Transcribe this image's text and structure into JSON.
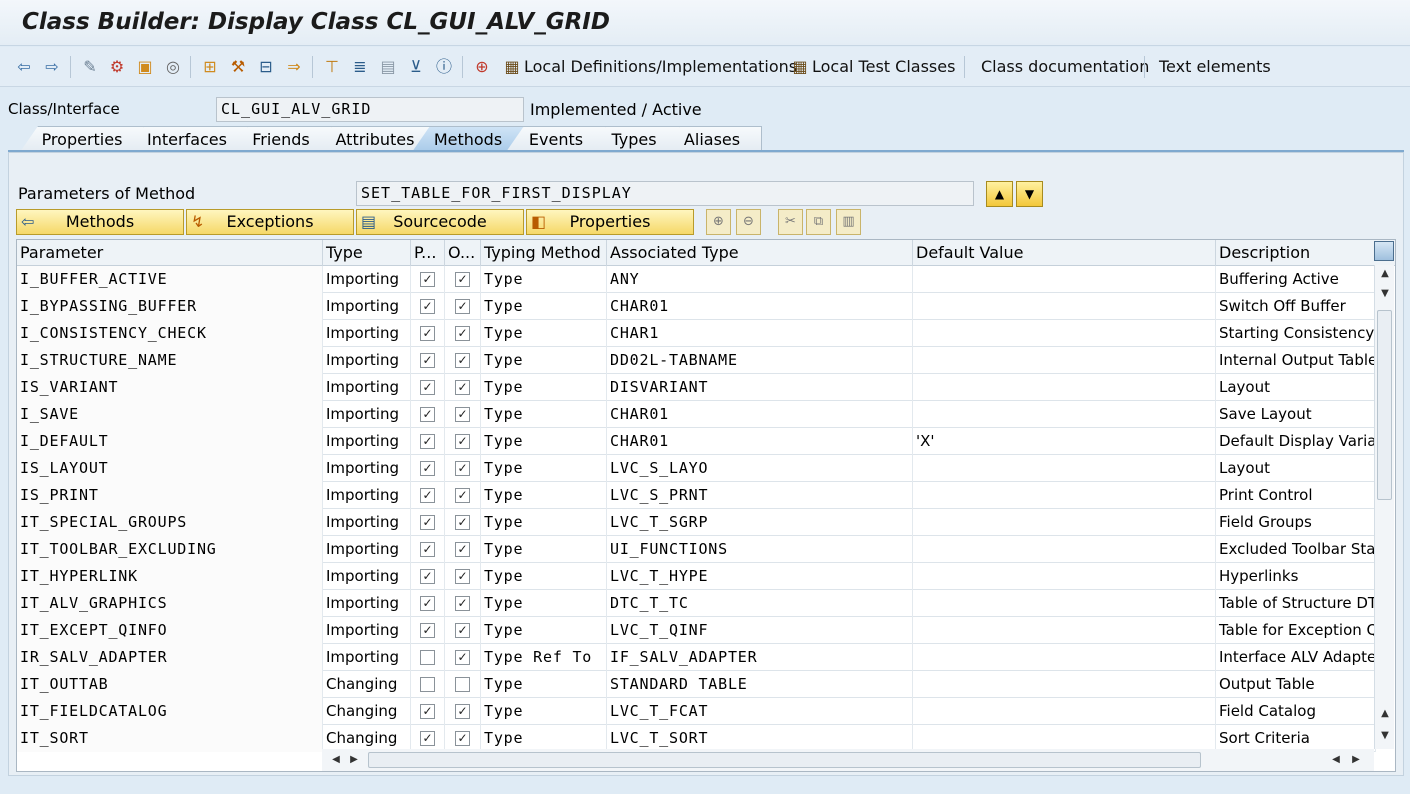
{
  "title": "Class Builder: Display Class CL_GUI_ALV_GRID",
  "toolbar": {
    "local_defs_label": "Local Definitions/Implementations",
    "local_tests_label": "Local Test Classes",
    "class_doc_label": "Class documentation",
    "text_elements_label": "Text elements"
  },
  "class_interface": {
    "label": "Class/Interface",
    "value": "CL_GUI_ALV_GRID",
    "status": "Implemented / Active"
  },
  "tabs": [
    "Properties",
    "Interfaces",
    "Friends",
    "Attributes",
    "Methods",
    "Events",
    "Types",
    "Aliases"
  ],
  "active_tab": "Methods",
  "method_params": {
    "label": "Parameters of Method",
    "value": "SET_TABLE_FOR_FIRST_DISPLAY"
  },
  "nav_buttons": {
    "methods": "Methods",
    "exceptions": "Exceptions",
    "sourcecode": "Sourcecode",
    "properties": "Properties"
  },
  "columns": {
    "parameter": "Parameter",
    "type": "Type",
    "pass_by_value": "P...",
    "optional": "O...",
    "typing_method": "Typing Method",
    "associated_type": "Associated Type",
    "default_value": "Default Value",
    "description": "Description"
  },
  "rows": [
    {
      "parameter": "I_BUFFER_ACTIVE",
      "type": "Importing",
      "p": true,
      "o": true,
      "typing": "Type",
      "assoc": "ANY",
      "default": "",
      "desc": "Buffering Active"
    },
    {
      "parameter": "I_BYPASSING_BUFFER",
      "type": "Importing",
      "p": true,
      "o": true,
      "typing": "Type",
      "assoc": "CHAR01",
      "default": "",
      "desc": "Switch Off Buffer"
    },
    {
      "parameter": "I_CONSISTENCY_CHECK",
      "type": "Importing",
      "p": true,
      "o": true,
      "typing": "Type",
      "assoc": "CHAR1",
      "default": "",
      "desc": "Starting Consistency C"
    },
    {
      "parameter": "I_STRUCTURE_NAME",
      "type": "Importing",
      "p": true,
      "o": true,
      "typing": "Type",
      "assoc": "DD02L-TABNAME",
      "default": "",
      "desc": "Internal Output Table"
    },
    {
      "parameter": "IS_VARIANT",
      "type": "Importing",
      "p": true,
      "o": true,
      "typing": "Type",
      "assoc": "DISVARIANT",
      "default": "",
      "desc": "Layout"
    },
    {
      "parameter": "I_SAVE",
      "type": "Importing",
      "p": true,
      "o": true,
      "typing": "Type",
      "assoc": "CHAR01",
      "default": "",
      "desc": "Save Layout"
    },
    {
      "parameter": "I_DEFAULT",
      "type": "Importing",
      "p": true,
      "o": true,
      "typing": "Type",
      "assoc": "CHAR01",
      "default": "'X'",
      "desc": "Default Display Variar"
    },
    {
      "parameter": "IS_LAYOUT",
      "type": "Importing",
      "p": true,
      "o": true,
      "typing": "Type",
      "assoc": "LVC_S_LAYO",
      "default": "",
      "desc": "Layout"
    },
    {
      "parameter": "IS_PRINT",
      "type": "Importing",
      "p": true,
      "o": true,
      "typing": "Type",
      "assoc": "LVC_S_PRNT",
      "default": "",
      "desc": "Print Control"
    },
    {
      "parameter": "IT_SPECIAL_GROUPS",
      "type": "Importing",
      "p": true,
      "o": true,
      "typing": "Type",
      "assoc": "LVC_T_SGRP",
      "default": "",
      "desc": "Field Groups"
    },
    {
      "parameter": "IT_TOOLBAR_EXCLUDING",
      "type": "Importing",
      "p": true,
      "o": true,
      "typing": "Type",
      "assoc": "UI_FUNCTIONS",
      "default": "",
      "desc": "Excluded Toolbar Star"
    },
    {
      "parameter": "IT_HYPERLINK",
      "type": "Importing",
      "p": true,
      "o": true,
      "typing": "Type",
      "assoc": "LVC_T_HYPE",
      "default": "",
      "desc": "Hyperlinks"
    },
    {
      "parameter": "IT_ALV_GRAPHICS",
      "type": "Importing",
      "p": true,
      "o": true,
      "typing": "Type",
      "assoc": "DTC_T_TC",
      "default": "",
      "desc": "Table of Structure DT"
    },
    {
      "parameter": "IT_EXCEPT_QINFO",
      "type": "Importing",
      "p": true,
      "o": true,
      "typing": "Type",
      "assoc": "LVC_T_QINF",
      "default": "",
      "desc": "Table for Exception Q"
    },
    {
      "parameter": "IR_SALV_ADAPTER",
      "type": "Importing",
      "p": false,
      "o": true,
      "typing": "Type Ref To",
      "assoc": "IF_SALV_ADAPTER",
      "default": "",
      "desc": "Interface ALV Adapter"
    },
    {
      "parameter": "IT_OUTTAB",
      "type": "Changing",
      "p": false,
      "o": false,
      "typing": "Type",
      "assoc": "STANDARD TABLE",
      "default": "",
      "desc": "Output Table"
    },
    {
      "parameter": "IT_FIELDCATALOG",
      "type": "Changing",
      "p": true,
      "o": true,
      "typing": "Type",
      "assoc": "LVC_T_FCAT",
      "default": "",
      "desc": "Field Catalog"
    },
    {
      "parameter": "IT_SORT",
      "type": "Changing",
      "p": true,
      "o": true,
      "typing": "Type",
      "assoc": "LVC_T_SORT",
      "default": "",
      "desc": "Sort Criteria"
    }
  ],
  "colors": {
    "accent": "#7fa9cf",
    "button_yellow": "#f5d868",
    "background": "#dfebf5"
  }
}
